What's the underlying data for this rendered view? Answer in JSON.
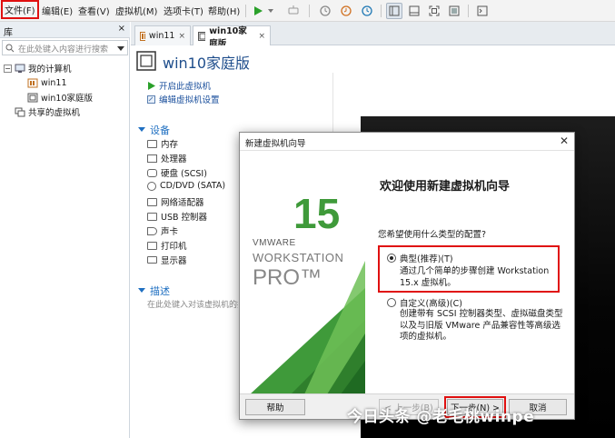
{
  "menu": {
    "items": [
      "文件(F)",
      "编辑(E)",
      "查看(V)",
      "虚拟机(M)",
      "选项卡(T)",
      "帮助(H)"
    ]
  },
  "library": {
    "title": "库",
    "search_placeholder": "在此处键入内容进行搜索",
    "tree": {
      "my_computer": "我的计算机",
      "vm1": "win11",
      "vm2": "win10家庭版",
      "shared": "共享的虚拟机"
    }
  },
  "tabs": [
    {
      "label": "win11"
    },
    {
      "label": "win10家庭版"
    }
  ],
  "vm_page": {
    "title": "win10家庭版",
    "actions": [
      "开启此虚拟机",
      "编辑虚拟机设置"
    ],
    "devices_title": "设备",
    "devices": [
      "内存",
      "处理器",
      "硬盘 (SCSI)",
      "CD/DVD (SATA)",
      "网络适配器",
      "USB 控制器",
      "声卡",
      "打印机",
      "显示器"
    ],
    "desc_title": "描述",
    "desc_placeholder": "在此处键入对该虚拟机的描"
  },
  "dialog": {
    "title": "新建虚拟机向导",
    "heading": "欢迎使用新建虚拟机向导",
    "question": "您希望使用什么类型的配置?",
    "brand": {
      "version": "15",
      "vendor": "VMWARE",
      "product": "WORKSTATION",
      "edition": "PRO™"
    },
    "option_typical": {
      "label": "典型(推荐)(T)",
      "desc": "通过几个简单的步骤创建 Workstation 15.x 虚拟机。",
      "selected": true
    },
    "option_custom": {
      "label": "自定义(高级)(C)",
      "desc": "创建带有 SCSI 控制器类型、虚拟磁盘类型以及与旧版 VMware 产品兼容性等高级选项的虚拟机。",
      "selected": false
    },
    "buttons": {
      "help": "帮助",
      "back": "< 上一步(B)",
      "next": "下一步(N) >",
      "cancel": "取消"
    }
  },
  "watermark": "今日头条 @老毛桃winpe",
  "colors": {
    "highlight": "#e01010",
    "section_blue": "#1f6fc1",
    "vmware_green": "#3f9a3a"
  }
}
